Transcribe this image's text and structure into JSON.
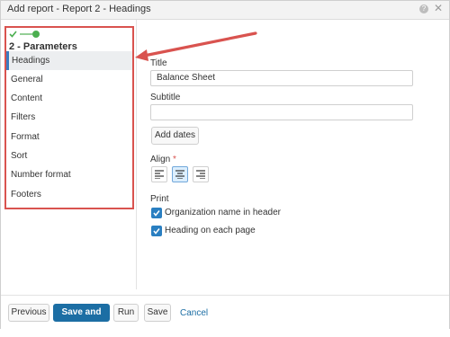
{
  "window": {
    "title": "Add report - Report 2 - Headings",
    "help_icon": "help-icon",
    "close_icon": "close-icon"
  },
  "sidebar": {
    "step_title": "2 - Parameters",
    "items": [
      {
        "label": "Headings",
        "active": true
      },
      {
        "label": "General"
      },
      {
        "label": "Content"
      },
      {
        "label": "Filters"
      },
      {
        "label": "Format"
      },
      {
        "label": "Sort"
      },
      {
        "label": "Number format"
      },
      {
        "label": "Footers"
      }
    ]
  },
  "main": {
    "title_label": "Title",
    "title_value": "Balance Sheet",
    "subtitle_label": "Subtitle",
    "subtitle_value": "",
    "add_dates_label": "Add dates",
    "align_label": "Align",
    "align_required": "*",
    "align_options": [
      "left",
      "center",
      "right"
    ],
    "align_selected": "center",
    "print_label": "Print",
    "print_options": [
      {
        "label": "Organization name in header",
        "checked": true
      },
      {
        "label": "Heading on each page",
        "checked": true
      }
    ]
  },
  "footer": {
    "previous_label": "Previous",
    "save_and_run_label": "Save and run",
    "run_label": "Run",
    "save_label": "Save",
    "cancel_label": "Cancel"
  },
  "colors": {
    "accent": "#1c6ea4",
    "highlight_annotation": "#d9534f",
    "progress_green": "#4caf50"
  }
}
